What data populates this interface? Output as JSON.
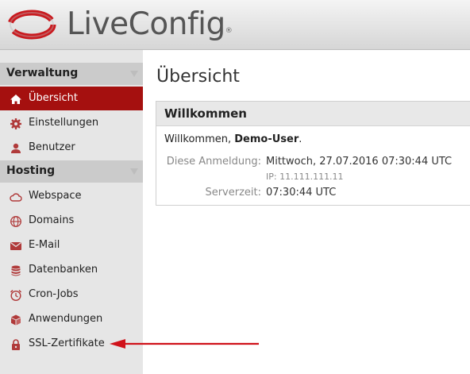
{
  "brand": {
    "name": "LiveConfig",
    "reg": "®"
  },
  "sidebar": {
    "sections": [
      {
        "title": "Verwaltung"
      },
      {
        "title": "Hosting"
      }
    ],
    "items": [
      {
        "label": "Übersicht",
        "icon": "home-icon"
      },
      {
        "label": "Einstellungen",
        "icon": "gear-icon"
      },
      {
        "label": "Benutzer",
        "icon": "user-icon"
      },
      {
        "label": "Webspace",
        "icon": "cloud-icon"
      },
      {
        "label": "Domains",
        "icon": "globe-icon"
      },
      {
        "label": "E-Mail",
        "icon": "envelope-icon"
      },
      {
        "label": "Datenbanken",
        "icon": "database-icon"
      },
      {
        "label": "Cron-Jobs",
        "icon": "clock-icon"
      },
      {
        "label": "Anwendungen",
        "icon": "box-icon"
      },
      {
        "label": "SSL-Zertifikate",
        "icon": "lock-icon"
      }
    ]
  },
  "main": {
    "title": "Übersicht",
    "panel": {
      "title": "Willkommen",
      "greeting_prefix": "Willkommen,",
      "user": "Demo-User",
      "greeting_suffix": ".",
      "last_login_label": "Diese Anmeldung:",
      "last_login_value": "Mittwoch, 27.07.2016 07:30:44 UTC",
      "ip": "IP: 11.111.111.11",
      "server_time_label": "Serverzeit:",
      "server_time_value": "07:30:44 UTC"
    }
  },
  "colors": {
    "accent": "#a5100f",
    "arrow": "#d0121a",
    "icon": "#b03a3a"
  }
}
